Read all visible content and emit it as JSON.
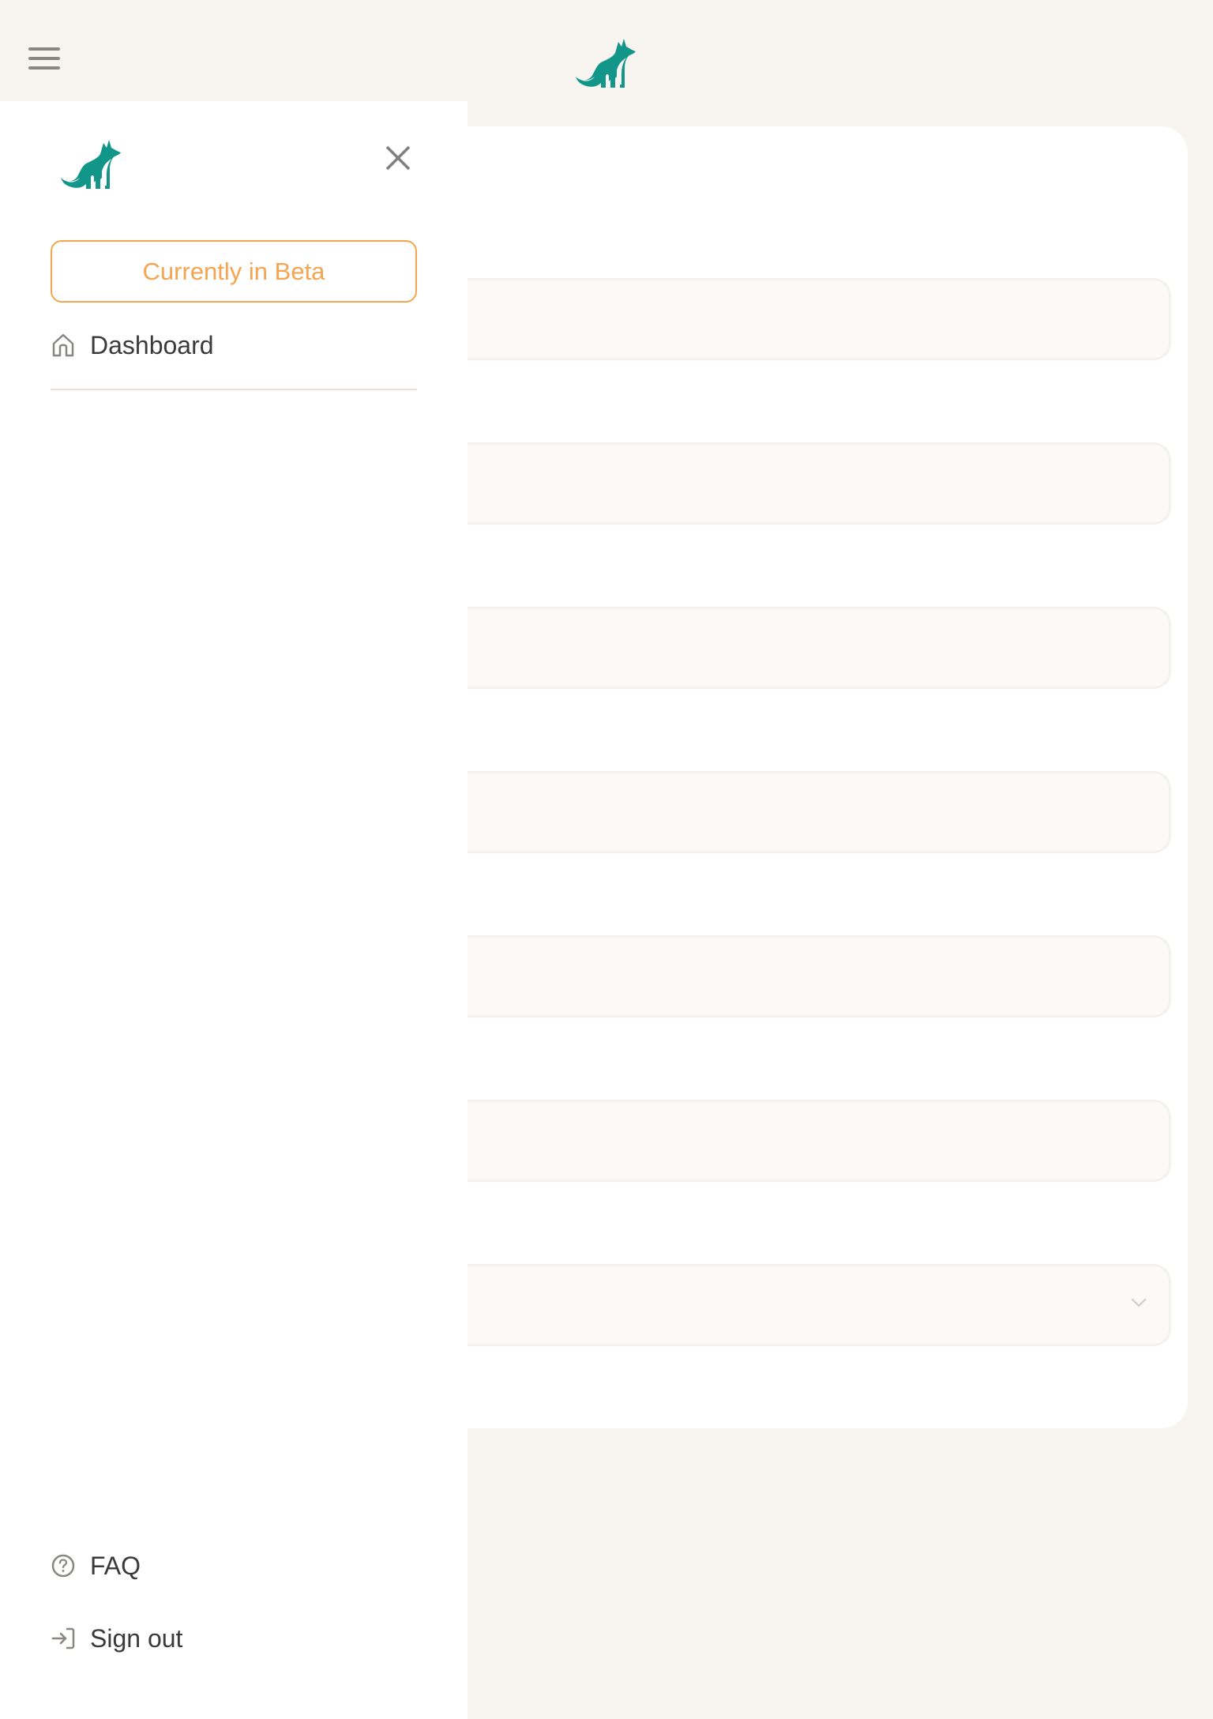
{
  "header": {
    "menu_icon": "hamburger-menu-icon",
    "logo_icon": "fox-logo-icon"
  },
  "sidebar": {
    "logo_icon": "fox-logo-icon",
    "close_icon": "close-icon",
    "beta_label": "Currently in Beta",
    "nav_items": [
      {
        "label": "Dashboard",
        "icon": "home-icon"
      }
    ],
    "footer_items": [
      {
        "label": "FAQ",
        "icon": "help-circle-icon"
      },
      {
        "label": "Sign out",
        "icon": "sign-out-icon"
      }
    ]
  },
  "main": {
    "fields": [
      {
        "type": "text",
        "value": ""
      },
      {
        "type": "text",
        "value": ""
      },
      {
        "type": "text",
        "value": ""
      },
      {
        "type": "text",
        "value": ""
      },
      {
        "type": "text",
        "value": ""
      },
      {
        "type": "text",
        "value": ""
      },
      {
        "type": "select",
        "value": "",
        "icon": "chevron-down-icon"
      }
    ]
  },
  "colors": {
    "brand_teal": "#13968a",
    "beta_orange": "#f5a551",
    "page_bg": "#f8f4ef",
    "text": "#3a3a3a",
    "icon_gray": "#8a8783"
  }
}
